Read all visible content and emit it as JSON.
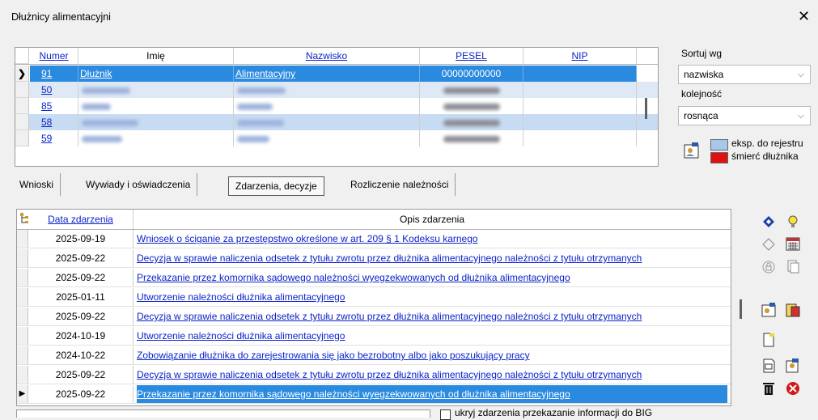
{
  "window": {
    "title": "Dłużnicy alimentacyjni",
    "close_glyph": "✕"
  },
  "debtors_grid": {
    "columns": {
      "numer": "Numer",
      "imie": "Imię",
      "nazwisko": "Nazwisko",
      "pesel": "PESEL",
      "nip": "NIP"
    },
    "rows": [
      {
        "numer": "91",
        "imie": "Dłużnik",
        "nazwisko": "Alimentacyjny",
        "pesel": "00000000000",
        "selected": true
      },
      {
        "numer": "50"
      },
      {
        "numer": "85"
      },
      {
        "numer": "58"
      },
      {
        "numer": "59"
      }
    ],
    "current_row_marker": "❯"
  },
  "sort": {
    "label": "Sortuj wg",
    "value": "nazwiska",
    "order_label": "kolejność",
    "order_value": "rosnąca",
    "chevron": "⌵"
  },
  "legend": {
    "export_label": "eksp. do rejestru",
    "export_color": "#a9c7ea",
    "death_label": "śmierć dłużnika",
    "death_color": "#e01010"
  },
  "tabs": [
    "Wnioski",
    "Wywiady i oświadczenia",
    "Zdarzenia, decyzje",
    "Rozliczenie należności"
  ],
  "events_grid": {
    "col_date": "Data zdarzenia",
    "col_desc": "Opis zdarzenia",
    "rows": [
      {
        "date": "2025-09-19",
        "desc": "Wniosek o ściganie za przestępstwo określone w art. 209 § 1 Kodeksu karnego"
      },
      {
        "date": "2025-09-22",
        "desc": "Decyzja w sprawie naliczenia odsetek z tytułu zwrotu przez dłużnika alimentacyjnego należności z tytułu otrzymanych"
      },
      {
        "date": "2025-09-22",
        "desc": "Przekazanie przez komornika sądowego należności wyegzekwowanych od dłużnika alimentacyjnego"
      },
      {
        "date": "2025-01-11",
        "desc": "Utworzenie należności dłużnika alimentacyjnego"
      },
      {
        "date": "2025-09-22",
        "desc": "Decyzja w sprawie naliczenia odsetek z tytułu zwrotu przez dłużnika alimentacyjnego należności z tytułu otrzymanych"
      },
      {
        "date": "2024-10-19",
        "desc": "Utworzenie należności dłużnika alimentacyjnego"
      },
      {
        "date": "2024-10-22",
        "desc": "Zobowiązanie dłużnika do zarejestrowania się jako bezrobotny albo jako poszukujący pracy"
      },
      {
        "date": "2025-09-22",
        "desc": "Decyzja w sprawie naliczenia odsetek z tytułu zwrotu przez dłużnika alimentacyjnego należności z tytułu otrzymanych"
      },
      {
        "date": "2025-09-22",
        "desc": "Przekazanie przez komornika sądowego należności wyegzekwowanych od dłużnika alimentacyjnego",
        "active": true
      }
    ],
    "current_row_marker": "▶"
  },
  "bottom_checkbox_label": "ukryj zdarzenia przekazanie informacji do BIG",
  "toolbar_icons": [
    "edit-icon",
    "bulb-icon",
    "eraser-icon",
    "calendar-icon",
    "lock-icon",
    "copy-icon",
    "report-icon",
    "person-card-icon",
    "new-doc-icon",
    "printer-icon",
    "preview-icon",
    "trash-icon",
    "cancel-icon"
  ]
}
